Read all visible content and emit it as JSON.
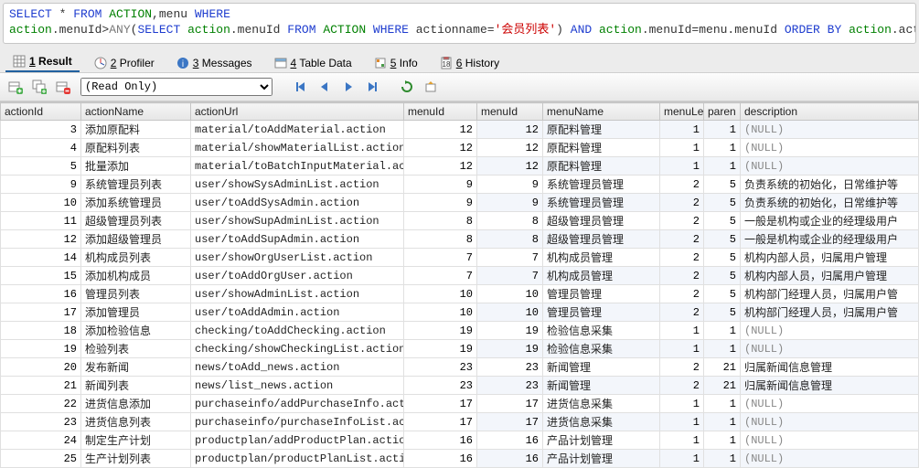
{
  "sql": {
    "line1_parts": [
      {
        "t": "SELECT ",
        "c": "kw-blue"
      },
      {
        "t": "* ",
        "c": "plain"
      },
      {
        "t": "FROM ",
        "c": "kw-blue"
      },
      {
        "t": "ACTION",
        "c": "kw-green"
      },
      {
        "t": ",menu ",
        "c": "plain"
      },
      {
        "t": "WHERE",
        "c": "kw-blue"
      }
    ],
    "line2_parts": [
      {
        "t": "action",
        "c": "kw-green"
      },
      {
        "t": ".menuId>",
        "c": "plain"
      },
      {
        "t": "ANY",
        "c": "kw-gray"
      },
      {
        "t": "(",
        "c": "plain"
      },
      {
        "t": "SELECT ",
        "c": "kw-blue"
      },
      {
        "t": "action",
        "c": "kw-green"
      },
      {
        "t": ".menuId ",
        "c": "plain"
      },
      {
        "t": "FROM ",
        "c": "kw-blue"
      },
      {
        "t": "ACTION ",
        "c": "kw-green"
      },
      {
        "t": "WHERE ",
        "c": "kw-blue"
      },
      {
        "t": "actionname=",
        "c": "plain"
      },
      {
        "t": "'会员列表'",
        "c": "kw-red"
      },
      {
        "t": ") ",
        "c": "plain"
      },
      {
        "t": "AND ",
        "c": "kw-blue"
      },
      {
        "t": "action",
        "c": "kw-green"
      },
      {
        "t": ".menuId=menu.menuId ",
        "c": "plain"
      },
      {
        "t": "ORDER BY ",
        "c": "kw-blue"
      },
      {
        "t": "action",
        "c": "kw-green"
      },
      {
        "t": ".actionId;",
        "c": "plain"
      }
    ]
  },
  "tabs": {
    "result": {
      "key": "1",
      "label": "Result"
    },
    "profiler": {
      "key": "2",
      "label": "Profiler"
    },
    "messages": {
      "key": "3",
      "label": "Messages"
    },
    "tabledata": {
      "key": "4",
      "label": "Table Data"
    },
    "info": {
      "key": "5",
      "label": "Info"
    },
    "history": {
      "key": "6",
      "label": "History"
    }
  },
  "toolbar": {
    "mode": "(Read Only)"
  },
  "grid": {
    "headers": {
      "actionId": "actionId",
      "actionName": "actionName",
      "actionUrl": "actionUrl",
      "menuId": "menuId",
      "menuId2": "menuId",
      "menuName": "menuName",
      "menuLe": "menuLe",
      "paren": "paren",
      "description": "description"
    },
    "null": "(NULL)",
    "rows": [
      {
        "actionId": 3,
        "actionName": "添加原配料",
        "actionUrl": "material/toAddMaterial.action",
        "menuId": 12,
        "menuId2": 12,
        "menuName": "原配料管理",
        "menuLe": 1,
        "paren": 1,
        "description": "(NULL)"
      },
      {
        "actionId": 4,
        "actionName": "原配料列表",
        "actionUrl": "material/showMaterialList.action",
        "menuId": 12,
        "menuId2": 12,
        "menuName": "原配料管理",
        "menuLe": 1,
        "paren": 1,
        "description": "(NULL)"
      },
      {
        "actionId": 5,
        "actionName": "批量添加",
        "actionUrl": "material/toBatchInputMaterial.ac",
        "menuId": 12,
        "menuId2": 12,
        "menuName": "原配料管理",
        "menuLe": 1,
        "paren": 1,
        "description": "(NULL)"
      },
      {
        "actionId": 9,
        "actionName": "系统管理员列表",
        "actionUrl": "user/showSysAdminList.action",
        "menuId": 9,
        "menuId2": 9,
        "menuName": "系统管理员管理",
        "menuLe": 2,
        "paren": 5,
        "description": "负责系统的初始化，日常维护等"
      },
      {
        "actionId": 10,
        "actionName": "添加系统管理员",
        "actionUrl": "user/toAddSysAdmin.action",
        "menuId": 9,
        "menuId2": 9,
        "menuName": "系统管理员管理",
        "menuLe": 2,
        "paren": 5,
        "description": "负责系统的初始化，日常维护等"
      },
      {
        "actionId": 11,
        "actionName": "超级管理员列表",
        "actionUrl": "user/showSupAdminList.action",
        "menuId": 8,
        "menuId2": 8,
        "menuName": "超级管理员管理",
        "menuLe": 2,
        "paren": 5,
        "description": "一般是机构或企业的经理级用户"
      },
      {
        "actionId": 12,
        "actionName": "添加超级管理员",
        "actionUrl": "user/toAddSupAdmin.action",
        "menuId": 8,
        "menuId2": 8,
        "menuName": "超级管理员管理",
        "menuLe": 2,
        "paren": 5,
        "description": "一般是机构或企业的经理级用户"
      },
      {
        "actionId": 14,
        "actionName": "机构成员列表",
        "actionUrl": "user/showOrgUserList.action",
        "menuId": 7,
        "menuId2": 7,
        "menuName": "机构成员管理",
        "menuLe": 2,
        "paren": 5,
        "description": "机构内部人员，归属用户管理"
      },
      {
        "actionId": 15,
        "actionName": "添加机构成员",
        "actionUrl": "user/toAddOrgUser.action",
        "menuId": 7,
        "menuId2": 7,
        "menuName": "机构成员管理",
        "menuLe": 2,
        "paren": 5,
        "description": "机构内部人员，归属用户管理"
      },
      {
        "actionId": 16,
        "actionName": "管理员列表",
        "actionUrl": "user/showAdminList.action",
        "menuId": 10,
        "menuId2": 10,
        "menuName": "管理员管理",
        "menuLe": 2,
        "paren": 5,
        "description": "机构部门经理人员，归属用户管"
      },
      {
        "actionId": 17,
        "actionName": "添加管理员",
        "actionUrl": "user/toAddAdmin.action",
        "menuId": 10,
        "menuId2": 10,
        "menuName": "管理员管理",
        "menuLe": 2,
        "paren": 5,
        "description": "机构部门经理人员，归属用户管"
      },
      {
        "actionId": 18,
        "actionName": "添加检验信息",
        "actionUrl": "checking/toAddChecking.action",
        "menuId": 19,
        "menuId2": 19,
        "menuName": "检验信息采集",
        "menuLe": 1,
        "paren": 1,
        "description": "(NULL)"
      },
      {
        "actionId": 19,
        "actionName": "检验列表",
        "actionUrl": "checking/showCheckingList.action",
        "menuId": 19,
        "menuId2": 19,
        "menuName": "检验信息采集",
        "menuLe": 1,
        "paren": 1,
        "description": "(NULL)"
      },
      {
        "actionId": 20,
        "actionName": "发布新闻",
        "actionUrl": "news/toAdd_news.action",
        "menuId": 23,
        "menuId2": 23,
        "menuName": "新闻管理",
        "menuLe": 2,
        "paren": 21,
        "description": "归属新闻信息管理"
      },
      {
        "actionId": 21,
        "actionName": "新闻列表",
        "actionUrl": "news/list_news.action",
        "menuId": 23,
        "menuId2": 23,
        "menuName": "新闻管理",
        "menuLe": 2,
        "paren": 21,
        "description": "归属新闻信息管理"
      },
      {
        "actionId": 22,
        "actionName": "进货信息添加",
        "actionUrl": "purchaseinfo/addPurchaseInfo.act",
        "menuId": 17,
        "menuId2": 17,
        "menuName": "进货信息采集",
        "menuLe": 1,
        "paren": 1,
        "description": "(NULL)"
      },
      {
        "actionId": 23,
        "actionName": "进货信息列表",
        "actionUrl": "purchaseinfo/purchaseInfoList.ac",
        "menuId": 17,
        "menuId2": 17,
        "menuName": "进货信息采集",
        "menuLe": 1,
        "paren": 1,
        "description": "(NULL)"
      },
      {
        "actionId": 24,
        "actionName": "制定生产计划",
        "actionUrl": "productplan/addProductPlan.actio",
        "menuId": 16,
        "menuId2": 16,
        "menuName": "产品计划管理",
        "menuLe": 1,
        "paren": 1,
        "description": "(NULL)"
      },
      {
        "actionId": 25,
        "actionName": "生产计划列表",
        "actionUrl": "productplan/productPlanList.acti",
        "menuId": 16,
        "menuId2": 16,
        "menuName": "产品计划管理",
        "menuLe": 1,
        "paren": 1,
        "description": "(NULL)"
      }
    ]
  }
}
